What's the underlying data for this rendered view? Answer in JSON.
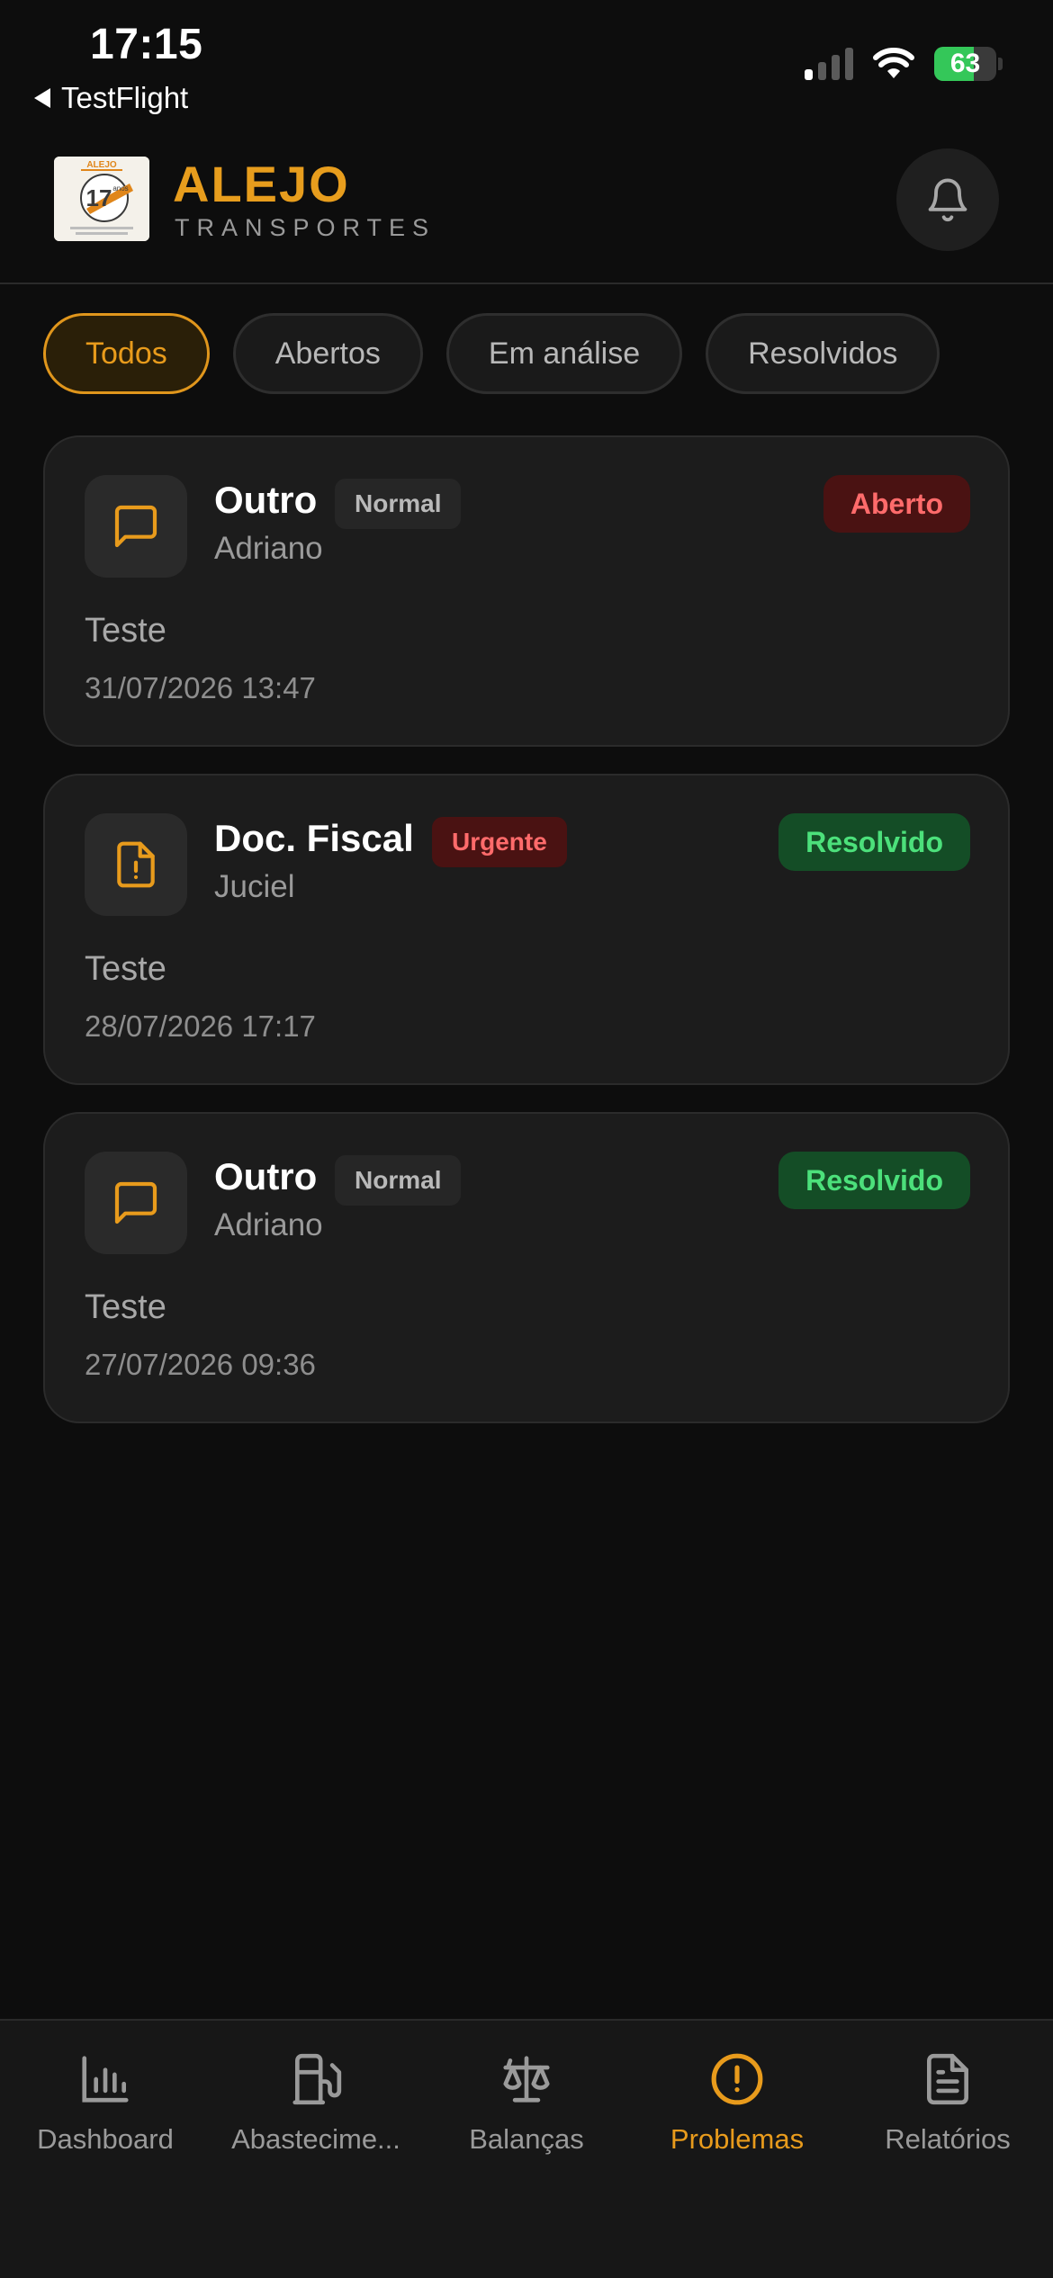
{
  "status_bar": {
    "time": "17:15",
    "back_label": "TestFlight",
    "battery": "63",
    "battery_level": 0.63,
    "signal_bars_active": 1,
    "signal_bars_total": 4
  },
  "header": {
    "logo_text": "ALEJO",
    "logo_years": "17",
    "logo_years_label": "anos",
    "brand_name": "ALEJO",
    "brand_sub": "TRANSPORTES",
    "notification_icon": "bell-icon"
  },
  "filters": [
    {
      "label": "Todos",
      "active": true
    },
    {
      "label": "Abertos",
      "active": false
    },
    {
      "label": "Em análise",
      "active": false
    },
    {
      "label": "Resolvidos",
      "active": false
    }
  ],
  "cards": [
    {
      "icon": "message-square-icon",
      "title": "Outro",
      "priority": "Normal",
      "person": "Adriano",
      "status": "Aberto",
      "description": "Teste",
      "date": "31/07/2026 13:47"
    },
    {
      "icon": "file-alert-icon",
      "title": "Doc. Fiscal",
      "priority": "Urgente",
      "person": "Juciel",
      "status": "Resolvido",
      "description": "Teste",
      "date": "28/07/2026 17:17"
    },
    {
      "icon": "message-square-icon",
      "title": "Outro",
      "priority": "Normal",
      "person": "Adriano",
      "status": "Resolvido",
      "description": "Teste",
      "date": "27/07/2026 09:36"
    }
  ],
  "tabbar": [
    {
      "label": "Dashboard",
      "icon": "bar-chart-icon",
      "active": false
    },
    {
      "label": "Abastecime...",
      "icon": "fuel-pump-icon",
      "active": false
    },
    {
      "label": "Balanças",
      "icon": "scale-icon",
      "active": false
    },
    {
      "label": "Problemas",
      "icon": "alert-circle-icon",
      "active": true
    },
    {
      "label": "Relatórios",
      "icon": "document-icon",
      "active": false
    }
  ],
  "colors": {
    "accent": "#e89b1c",
    "background": "#0d0d0d",
    "card": "#1c1c1c",
    "status_open": "#ff6b6b",
    "status_resolved": "#4ce07b"
  }
}
